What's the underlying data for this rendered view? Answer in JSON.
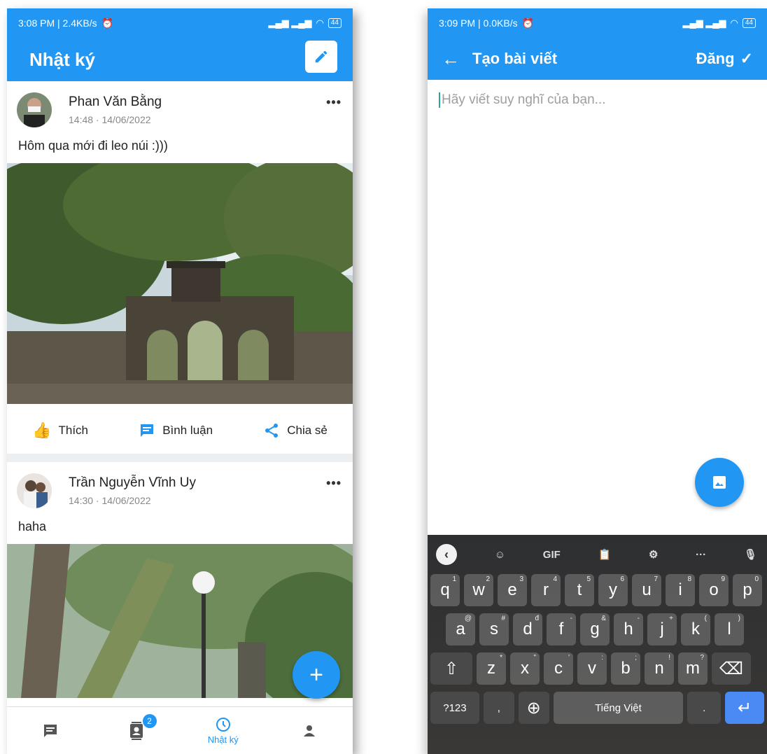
{
  "left": {
    "status": {
      "time": "3:08 PM | 2.4KB/s",
      "battery": "44"
    },
    "header": {
      "title": "Nhật ký"
    },
    "posts": [
      {
        "author": "Phan Văn Bằng",
        "time": "14:48 · 14/06/2022",
        "text": "Hôm qua mới đi leo núi :)))"
      },
      {
        "author": "Trần Nguyễn Vĩnh Uy",
        "time": "14:30 · 14/06/2022",
        "text": "haha"
      }
    ],
    "actions": {
      "like": "Thích",
      "comment": "Bình luận",
      "share": "Chia sẻ"
    },
    "fab": "+",
    "nav": {
      "badge": "2",
      "diary_label": "Nhật ký"
    }
  },
  "right": {
    "status": {
      "time": "3:09 PM | 0.0KB/s",
      "battery": "44"
    },
    "header": {
      "back": "←",
      "title": "Tạo bài viết",
      "post": "Đăng"
    },
    "compose": {
      "placeholder": "Hãy viết suy nghĩ của bạn..."
    },
    "keyboard": {
      "toolbar": {
        "gif": "GIF",
        "more": "···"
      },
      "row1": [
        {
          "k": "q",
          "h": "1"
        },
        {
          "k": "w",
          "h": "2"
        },
        {
          "k": "e",
          "h": "3"
        },
        {
          "k": "r",
          "h": "4"
        },
        {
          "k": "t",
          "h": "5"
        },
        {
          "k": "y",
          "h": "6"
        },
        {
          "k": "u",
          "h": "7"
        },
        {
          "k": "i",
          "h": "8"
        },
        {
          "k": "o",
          "h": "9"
        },
        {
          "k": "p",
          "h": "0"
        }
      ],
      "row2": [
        {
          "k": "a",
          "h": "@"
        },
        {
          "k": "s",
          "h": "#"
        },
        {
          "k": "d",
          "h": "đ"
        },
        {
          "k": "f",
          "h": "-"
        },
        {
          "k": "g",
          "h": "&"
        },
        {
          "k": "h",
          "h": "-"
        },
        {
          "k": "j",
          "h": "+"
        },
        {
          "k": "k",
          "h": "("
        },
        {
          "k": "l",
          "h": ")"
        }
      ],
      "row3": [
        {
          "k": "z",
          "h": "*"
        },
        {
          "k": "x",
          "h": "\""
        },
        {
          "k": "c",
          "h": "'"
        },
        {
          "k": "v",
          "h": ":"
        },
        {
          "k": "b",
          "h": ";"
        },
        {
          "k": "n",
          "h": "!"
        },
        {
          "k": "m",
          "h": "?"
        }
      ],
      "sym": "?123",
      "comma": ",",
      "space": "Tiếng Việt",
      "period": "."
    }
  }
}
